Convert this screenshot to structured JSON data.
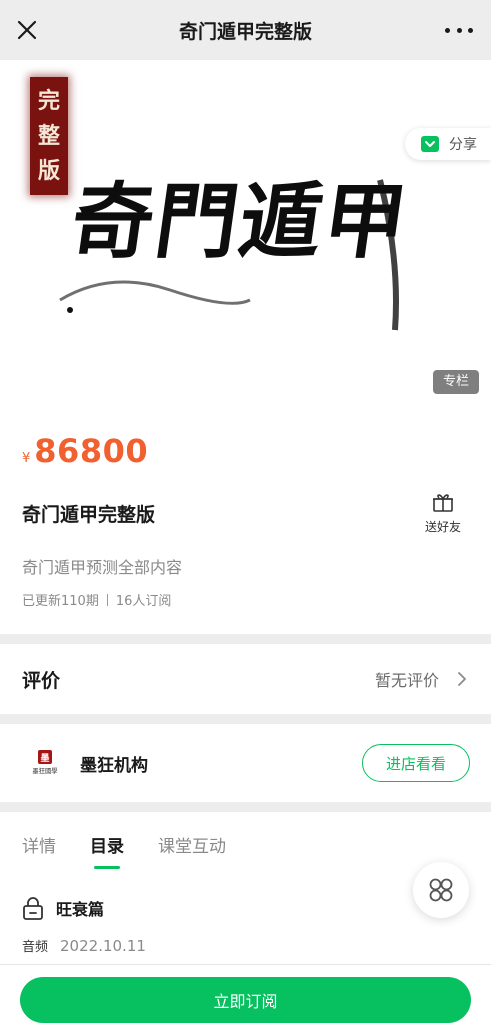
{
  "nav": {
    "title": "奇门遁甲完整版"
  },
  "banner": {
    "seal_chars": [
      "完",
      "整",
      "版"
    ],
    "calligraphy_text": "奇門遁甲",
    "share_label": "分享",
    "tag": "专栏"
  },
  "info": {
    "currency": "¥",
    "price": "86800",
    "title": "奇门遁甲完整版",
    "gift_label": "送好友",
    "description": "奇门遁甲预测全部内容",
    "updated": "已更新110期",
    "subscribers": "16人订阅"
  },
  "review": {
    "label": "评价",
    "value": "暂无评价"
  },
  "store": {
    "name": "墨狂机构",
    "logo_text": "墨狂國學",
    "button": "进店看看"
  },
  "tabs": [
    {
      "label": "详情"
    },
    {
      "label": "目录"
    },
    {
      "label": "课堂互动"
    }
  ],
  "lesson": {
    "title": "旺衰篇",
    "type": "音频",
    "date": "2022.10.11"
  },
  "bottom": {
    "subscribe": "立即订阅"
  },
  "colors": {
    "accent": "#07c160",
    "price": "#f0612f",
    "seal": "#7a1210"
  }
}
